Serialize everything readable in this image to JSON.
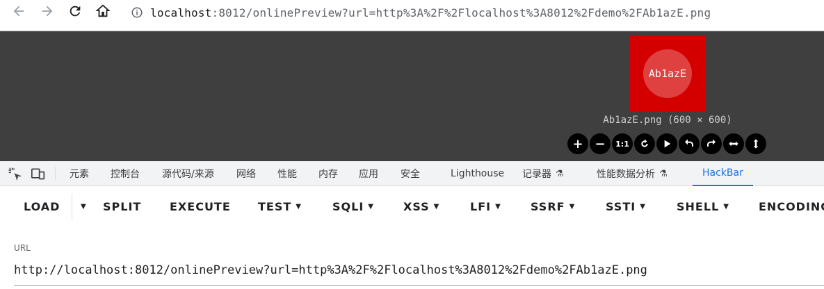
{
  "browser": {
    "url_host": "localhost",
    "url_rest": ":8012/onlinePreview?url=http%3A%2F%2Flocalhost%3A8012%2Fdemo%2FAb1azE.png"
  },
  "preview": {
    "logo_text": "Ab1azE",
    "caption": "Ab1azE.png (600 × 600)",
    "thumb_color": "#d40000",
    "tools": [
      {
        "name": "zoom-in-icon",
        "glyph": "+"
      },
      {
        "name": "zoom-out-icon",
        "glyph": "−"
      },
      {
        "name": "actual-size-icon",
        "glyph": "1:1"
      },
      {
        "name": "reset-icon",
        "glyph": ""
      },
      {
        "name": "play-icon",
        "glyph": ""
      },
      {
        "name": "rotate-left-icon",
        "glyph": ""
      },
      {
        "name": "rotate-right-icon",
        "glyph": ""
      },
      {
        "name": "flip-horizontal-icon",
        "glyph": ""
      },
      {
        "name": "flip-vertical-icon",
        "glyph": ""
      }
    ]
  },
  "devtools": {
    "tabs": [
      {
        "label": "元素"
      },
      {
        "label": "控制台"
      },
      {
        "label": "源代码/来源"
      },
      {
        "label": "网络"
      },
      {
        "label": "性能"
      },
      {
        "label": "内存"
      },
      {
        "label": "应用"
      },
      {
        "label": "安全"
      },
      {
        "label": "Lighthouse"
      },
      {
        "label": "记录器"
      },
      {
        "label": "性能数据分析"
      },
      {
        "label": "HackBar"
      }
    ],
    "active_tab": "HackBar",
    "accent": "#1a73e8"
  },
  "hackbar": {
    "items": [
      "LOAD",
      "SPLIT",
      "EXECUTE",
      "TEST",
      "SQLI",
      "XSS",
      "LFI",
      "SSRF",
      "SSTI",
      "SHELL",
      "ENCODING"
    ]
  },
  "url_field": {
    "label": "URL",
    "value": "http://localhost:8012/onlinePreview?url=http%3A%2F%2Flocalhost%3A8012%2Fdemo%2FAb1azE.png"
  }
}
